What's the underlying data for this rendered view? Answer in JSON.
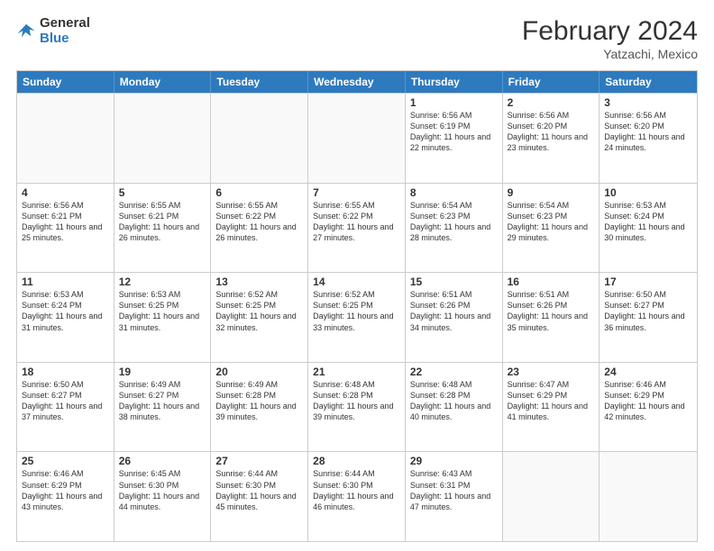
{
  "header": {
    "logo": {
      "general": "General",
      "blue": "Blue"
    },
    "title": "February 2024",
    "location": "Yatzachi, Mexico"
  },
  "days_of_week": [
    "Sunday",
    "Monday",
    "Tuesday",
    "Wednesday",
    "Thursday",
    "Friday",
    "Saturday"
  ],
  "rows": [
    [
      {
        "day": "",
        "empty": true
      },
      {
        "day": "",
        "empty": true
      },
      {
        "day": "",
        "empty": true
      },
      {
        "day": "",
        "empty": true
      },
      {
        "day": "1",
        "sunrise": "Sunrise: 6:56 AM",
        "sunset": "Sunset: 6:19 PM",
        "daylight": "Daylight: 11 hours and 22 minutes."
      },
      {
        "day": "2",
        "sunrise": "Sunrise: 6:56 AM",
        "sunset": "Sunset: 6:20 PM",
        "daylight": "Daylight: 11 hours and 23 minutes."
      },
      {
        "day": "3",
        "sunrise": "Sunrise: 6:56 AM",
        "sunset": "Sunset: 6:20 PM",
        "daylight": "Daylight: 11 hours and 24 minutes."
      }
    ],
    [
      {
        "day": "4",
        "sunrise": "Sunrise: 6:56 AM",
        "sunset": "Sunset: 6:21 PM",
        "daylight": "Daylight: 11 hours and 25 minutes."
      },
      {
        "day": "5",
        "sunrise": "Sunrise: 6:55 AM",
        "sunset": "Sunset: 6:21 PM",
        "daylight": "Daylight: 11 hours and 26 minutes."
      },
      {
        "day": "6",
        "sunrise": "Sunrise: 6:55 AM",
        "sunset": "Sunset: 6:22 PM",
        "daylight": "Daylight: 11 hours and 26 minutes."
      },
      {
        "day": "7",
        "sunrise": "Sunrise: 6:55 AM",
        "sunset": "Sunset: 6:22 PM",
        "daylight": "Daylight: 11 hours and 27 minutes."
      },
      {
        "day": "8",
        "sunrise": "Sunrise: 6:54 AM",
        "sunset": "Sunset: 6:23 PM",
        "daylight": "Daylight: 11 hours and 28 minutes."
      },
      {
        "day": "9",
        "sunrise": "Sunrise: 6:54 AM",
        "sunset": "Sunset: 6:23 PM",
        "daylight": "Daylight: 11 hours and 29 minutes."
      },
      {
        "day": "10",
        "sunrise": "Sunrise: 6:53 AM",
        "sunset": "Sunset: 6:24 PM",
        "daylight": "Daylight: 11 hours and 30 minutes."
      }
    ],
    [
      {
        "day": "11",
        "sunrise": "Sunrise: 6:53 AM",
        "sunset": "Sunset: 6:24 PM",
        "daylight": "Daylight: 11 hours and 31 minutes."
      },
      {
        "day": "12",
        "sunrise": "Sunrise: 6:53 AM",
        "sunset": "Sunset: 6:25 PM",
        "daylight": "Daylight: 11 hours and 31 minutes."
      },
      {
        "day": "13",
        "sunrise": "Sunrise: 6:52 AM",
        "sunset": "Sunset: 6:25 PM",
        "daylight": "Daylight: 11 hours and 32 minutes."
      },
      {
        "day": "14",
        "sunrise": "Sunrise: 6:52 AM",
        "sunset": "Sunset: 6:25 PM",
        "daylight": "Daylight: 11 hours and 33 minutes."
      },
      {
        "day": "15",
        "sunrise": "Sunrise: 6:51 AM",
        "sunset": "Sunset: 6:26 PM",
        "daylight": "Daylight: 11 hours and 34 minutes."
      },
      {
        "day": "16",
        "sunrise": "Sunrise: 6:51 AM",
        "sunset": "Sunset: 6:26 PM",
        "daylight": "Daylight: 11 hours and 35 minutes."
      },
      {
        "day": "17",
        "sunrise": "Sunrise: 6:50 AM",
        "sunset": "Sunset: 6:27 PM",
        "daylight": "Daylight: 11 hours and 36 minutes."
      }
    ],
    [
      {
        "day": "18",
        "sunrise": "Sunrise: 6:50 AM",
        "sunset": "Sunset: 6:27 PM",
        "daylight": "Daylight: 11 hours and 37 minutes."
      },
      {
        "day": "19",
        "sunrise": "Sunrise: 6:49 AM",
        "sunset": "Sunset: 6:27 PM",
        "daylight": "Daylight: 11 hours and 38 minutes."
      },
      {
        "day": "20",
        "sunrise": "Sunrise: 6:49 AM",
        "sunset": "Sunset: 6:28 PM",
        "daylight": "Daylight: 11 hours and 39 minutes."
      },
      {
        "day": "21",
        "sunrise": "Sunrise: 6:48 AM",
        "sunset": "Sunset: 6:28 PM",
        "daylight": "Daylight: 11 hours and 39 minutes."
      },
      {
        "day": "22",
        "sunrise": "Sunrise: 6:48 AM",
        "sunset": "Sunset: 6:28 PM",
        "daylight": "Daylight: 11 hours and 40 minutes."
      },
      {
        "day": "23",
        "sunrise": "Sunrise: 6:47 AM",
        "sunset": "Sunset: 6:29 PM",
        "daylight": "Daylight: 11 hours and 41 minutes."
      },
      {
        "day": "24",
        "sunrise": "Sunrise: 6:46 AM",
        "sunset": "Sunset: 6:29 PM",
        "daylight": "Daylight: 11 hours and 42 minutes."
      }
    ],
    [
      {
        "day": "25",
        "sunrise": "Sunrise: 6:46 AM",
        "sunset": "Sunset: 6:29 PM",
        "daylight": "Daylight: 11 hours and 43 minutes."
      },
      {
        "day": "26",
        "sunrise": "Sunrise: 6:45 AM",
        "sunset": "Sunset: 6:30 PM",
        "daylight": "Daylight: 11 hours and 44 minutes."
      },
      {
        "day": "27",
        "sunrise": "Sunrise: 6:44 AM",
        "sunset": "Sunset: 6:30 PM",
        "daylight": "Daylight: 11 hours and 45 minutes."
      },
      {
        "day": "28",
        "sunrise": "Sunrise: 6:44 AM",
        "sunset": "Sunset: 6:30 PM",
        "daylight": "Daylight: 11 hours and 46 minutes."
      },
      {
        "day": "29",
        "sunrise": "Sunrise: 6:43 AM",
        "sunset": "Sunset: 6:31 PM",
        "daylight": "Daylight: 11 hours and 47 minutes."
      },
      {
        "day": "",
        "empty": true
      },
      {
        "day": "",
        "empty": true
      }
    ]
  ]
}
